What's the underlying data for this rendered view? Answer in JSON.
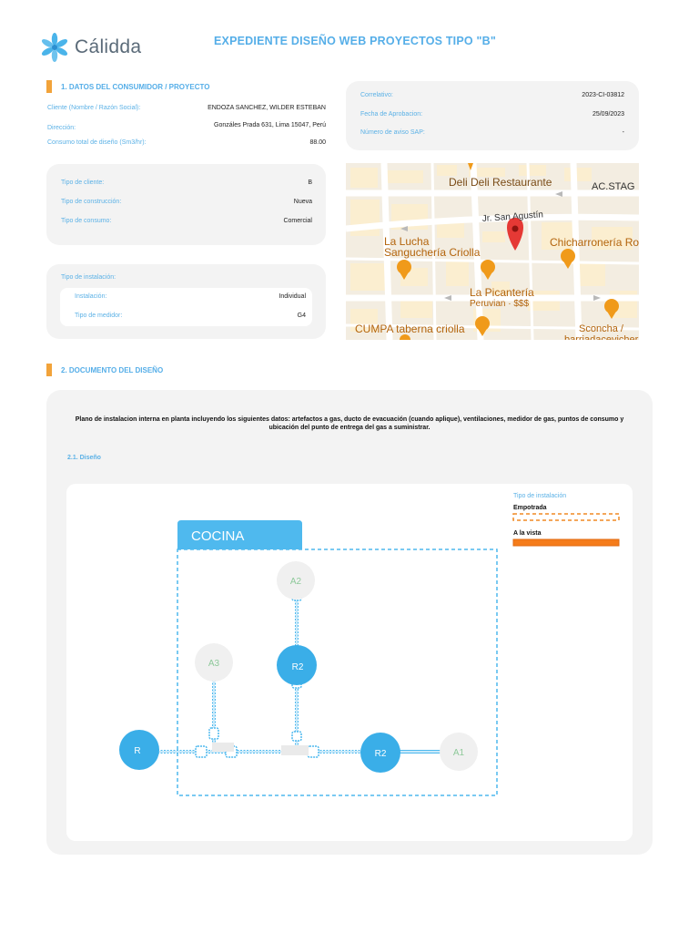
{
  "header": {
    "logo_text": "Cálidda",
    "title": "EXPEDIENTE DISEÑO WEB PROYECTOS TIPO \"B\""
  },
  "section1": {
    "label": "1. DATOS DEL CONSUMIDOR / PROYECTO",
    "client_label": "Cliente (Nombre / Razón Social):",
    "client_value": "ENDOZA SANCHEZ, WILDER ESTEBAN",
    "address_label": "Dirección:",
    "address_value": "Gonzáles Prada 631, Lima 15047, Perú",
    "consumption_label": "Consumo total de diseño (Sm3/hr):",
    "consumption_value": "88.00"
  },
  "info_card": {
    "correlativo_label": "Correlativo:",
    "correlativo_value": "2023-CI-03812",
    "approval_label": "Fecha de Aprobacion:",
    "approval_value": "25/09/2023",
    "sap_label": "Número de aviso SAP:",
    "sap_value": "-"
  },
  "client_card": {
    "tipo_cliente_label": "Tipo de cliente:",
    "tipo_cliente_value": "B",
    "tipo_construccion_label": "Tipo de construcción:",
    "tipo_construccion_value": "Nueva",
    "tipo_consumo_label": "Tipo de consumo:",
    "tipo_consumo_value": "Comercial"
  },
  "installation_card": {
    "title": "Tipo de instalación:",
    "instalacion_label": "Instalación:",
    "instalacion_value": "Individual",
    "medidor_label": "Tipo de medidor:",
    "medidor_value": "G4"
  },
  "map": {
    "labels": {
      "deli": "Deli Deli Restaurante",
      "acstag": "AC.STAG",
      "street": "Jr. San Agustín",
      "lucha1": "La Lucha",
      "lucha2": "Sanguchería Criolla",
      "chicharroneria": "Chicharronería Ro",
      "picanteria": "La Picantería",
      "picanteria_sub": "Peruvian · $$$",
      "cumpa": "CUMPA taberna criolla",
      "sconcha": "Sconcha /",
      "sconcha2": "barriadacevichera"
    }
  },
  "section2": {
    "label": "2. DOCUMENTO DEL DISEÑO",
    "description": "Plano de instalacion interna en planta incluyendo los siguientes datos: artefactos a gas, ducto de evacuación (cuando aplique), ventilaciones, medidor de gas, puntos de consumo y ubicación del punto de entrega del gas a suministrar.",
    "sublabel": "2.1. Diseño"
  },
  "diagram": {
    "room_label": "COCINA",
    "legend_title": "Tipo de instalación",
    "legend_embedded": "Empotrada",
    "legend_visible": "A la vista",
    "nodes": {
      "a2": "A2",
      "r2_top": "R2",
      "a3": "A3",
      "r_left": "R",
      "r2_right": "R2",
      "a1": "A1"
    },
    "colors": {
      "accent": "#55aee8",
      "node_blue": "#3aaee8",
      "node_ghost": "#f0f0f0",
      "embedded": "#f08a24",
      "visible": "#f57c1a"
    }
  }
}
